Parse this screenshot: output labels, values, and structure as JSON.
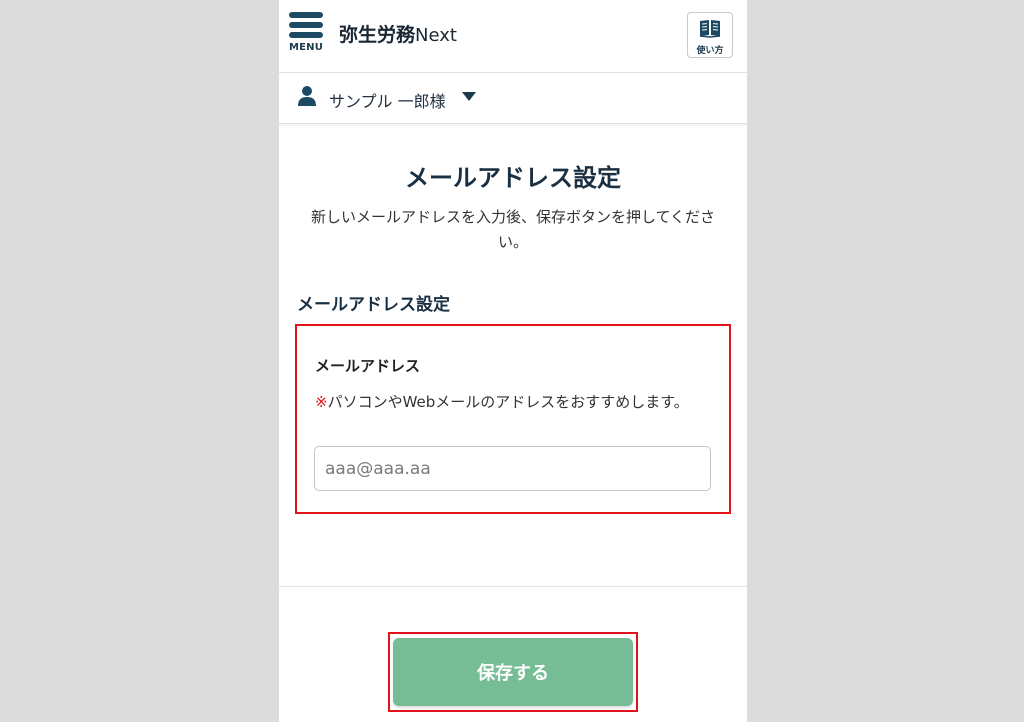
{
  "header": {
    "menu_label": "MENU",
    "app_name": "弥生労務",
    "app_suffix": "Next",
    "help_label": "使い方"
  },
  "user": {
    "name": "サンプル 一郎様"
  },
  "main": {
    "title": "メールアドレス設定",
    "description": "新しいメールアドレスを入力後、保存ボタンを押してください。",
    "section_heading": "メールアドレス設定",
    "field": {
      "label": "メールアドレス",
      "note_mark": "※",
      "note_text": "パソコンやWebメールのアドレスをおすすめします。",
      "placeholder": "aaa@aaa.aa",
      "value": ""
    }
  },
  "footer": {
    "save_label": "保存する"
  },
  "colors": {
    "brand_navy": "#1d4a63",
    "save_green": "#76bd96",
    "highlight_red": "#e0141a"
  }
}
